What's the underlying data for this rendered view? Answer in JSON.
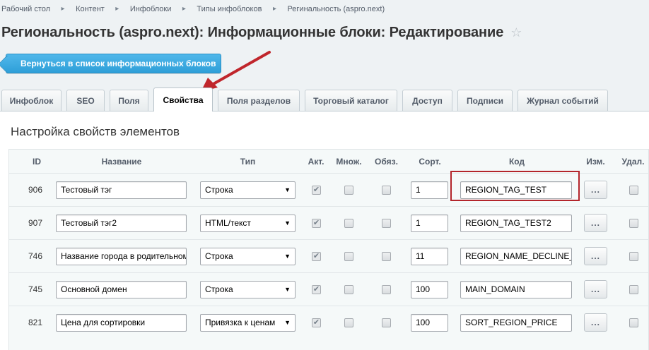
{
  "breadcrumb": [
    "Рабочий стол",
    "Контент",
    "Инфоблоки",
    "Типы инфоблоков",
    "Регинальность (aspro.next)"
  ],
  "breadcrumb_sep": "▸",
  "title": "Региональность (aspro.next): Информационные блоки: Редактирование",
  "star_icon": "☆",
  "back_button": "Вернуться в список информационных блоков",
  "tabs": [
    {
      "label": "Инфоблок",
      "active": false
    },
    {
      "label": "SEO",
      "active": false
    },
    {
      "label": "Поля",
      "active": false
    },
    {
      "label": "Свойства",
      "active": true
    },
    {
      "label": "Поля разделов",
      "active": false
    },
    {
      "label": "Торговый каталог",
      "active": false
    },
    {
      "label": "Доступ",
      "active": false
    },
    {
      "label": "Подписи",
      "active": false
    },
    {
      "label": "Журнал событий",
      "active": false
    }
  ],
  "section_title": "Настройка свойств элементов",
  "columns": {
    "id": "ID",
    "name": "Название",
    "type": "Тип",
    "active": "Акт.",
    "multiple": "Множ.",
    "required": "Обяз.",
    "sort": "Сорт.",
    "code": "Код",
    "edit": "Изм.",
    "delete": "Удал."
  },
  "rows": [
    {
      "id": "906",
      "name": "Тестовый тэг",
      "type": "Строка",
      "active": true,
      "multiple": false,
      "required": false,
      "sort": "1",
      "code": "REGION_TAG_TEST",
      "edit": "...",
      "highlighted": true
    },
    {
      "id": "907",
      "name": "Тестовый тэг2",
      "type": "HTML/текст",
      "active": true,
      "multiple": false,
      "required": false,
      "sort": "1",
      "code": "REGION_TAG_TEST2",
      "edit": "..."
    },
    {
      "id": "746",
      "name": "Название города в родительном",
      "type": "Строка",
      "active": true,
      "multiple": false,
      "required": false,
      "sort": "11",
      "code": "REGION_NAME_DECLINE_",
      "edit": "..."
    },
    {
      "id": "745",
      "name": "Основной домен",
      "type": "Строка",
      "active": true,
      "multiple": false,
      "required": false,
      "sort": "100",
      "code": "MAIN_DOMAIN",
      "edit": "..."
    },
    {
      "id": "821",
      "name": "Цена для сортировки",
      "type": "Привязка к ценам",
      "active": true,
      "multiple": false,
      "required": false,
      "sort": "100",
      "code": "SORT_REGION_PRICE",
      "edit": "..."
    }
  ],
  "colors": {
    "accent": "#2e9fd8",
    "highlight": "#b3252b",
    "arrow": "#c0262c"
  }
}
